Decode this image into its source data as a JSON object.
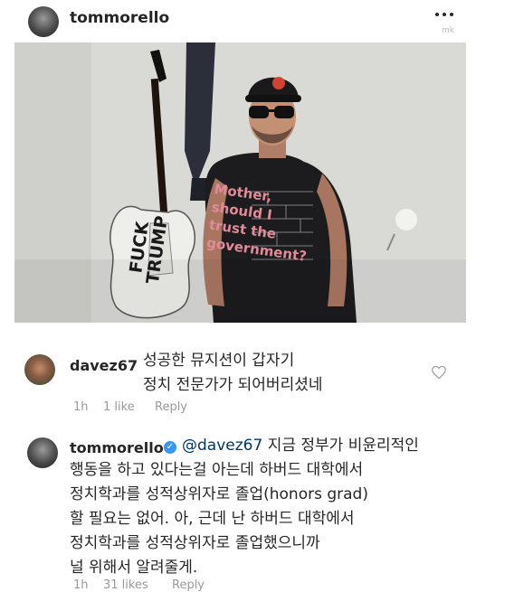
{
  "post": {
    "username": "tommorello",
    "more_icon": "ellipsis-icon",
    "watermark": "mk",
    "photo": {
      "guitar_text_line1": "FUCK",
      "guitar_text_line2": "TRUMP",
      "shirt_line1": "Mother,",
      "shirt_line2": "should I",
      "shirt_line3": "trust the",
      "shirt_line4": "government?"
    }
  },
  "comments": [
    {
      "username": "davez67",
      "text_lines": [
        "성공한 뮤지션이 갑자기",
        "정치 전문가가 되어버리셨네"
      ],
      "time": "1h",
      "likes": "1 like",
      "reply": "Reply"
    },
    {
      "username": "tommorello",
      "verified": true,
      "mention": "@davez67",
      "first_line_rest": " 지금 정부가 비윤리적인",
      "text_lines": [
        "행동을 하고 있다는걸 아는데 하버드 대학에서",
        "정치학과를 성적상위자로 졸업(honors grad)",
        "할 필요는 없어. 아, 근데 난 하버드 대학에서",
        "정치학과를 성적상위자로 졸업했으니까",
        "널 위해서 알려줄게."
      ],
      "time": "1h",
      "likes": "31 likes",
      "reply": "Reply"
    }
  ],
  "colors": {
    "text": "#262626",
    "meta": "#999999",
    "mention": "#003569",
    "verified": "#3897f0"
  }
}
